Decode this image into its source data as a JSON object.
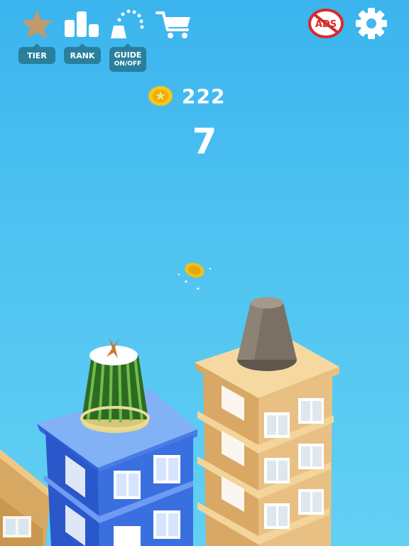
{
  "toolbar": {
    "tier": {
      "label": "TIER",
      "icon": "star-icon"
    },
    "rank": {
      "label": "RANK",
      "icon": "bar-chart-icon"
    },
    "guide": {
      "label": "GUIDE",
      "sublabel": "ON/OFF",
      "icon": "trajectory-icon"
    },
    "shop": {
      "icon": "cart-icon"
    }
  },
  "top_right": {
    "no_ads": {
      "label": "ADS",
      "icon": "no-ads-icon"
    },
    "settings": {
      "icon": "gear-icon"
    }
  },
  "hud": {
    "coins": "222",
    "score": "7"
  },
  "colors": {
    "sky_top": "#3bb4ee",
    "sky_bottom": "#62d0f3",
    "toolbar_tag": "#2a7f9c",
    "star": "#c19a6b",
    "coin": "#f7c51b",
    "no_ads_red": "#d62b2b",
    "building_blue": "#2f63d8",
    "building_tan": "#e2b878",
    "cup_grey": "#6f6659",
    "watermelon_green": "#3b7a2a"
  }
}
